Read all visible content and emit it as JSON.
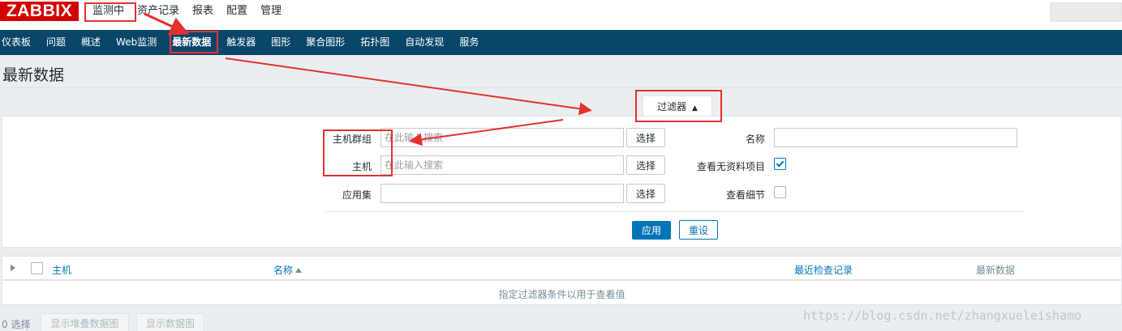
{
  "app": {
    "logo": "ZABBIX"
  },
  "top_nav": {
    "items": [
      {
        "label": "监测中",
        "active": true
      },
      {
        "label": "资产记录"
      },
      {
        "label": "报表"
      },
      {
        "label": "配置"
      },
      {
        "label": "管理"
      }
    ]
  },
  "sub_nav": {
    "items": [
      {
        "label": "仪表板"
      },
      {
        "label": "问题"
      },
      {
        "label": "概述"
      },
      {
        "label": "Web监测"
      },
      {
        "label": "最新数据",
        "active": true
      },
      {
        "label": "触发器"
      },
      {
        "label": "图形"
      },
      {
        "label": "聚合图形"
      },
      {
        "label": "拓扑图"
      },
      {
        "label": "自动发现"
      },
      {
        "label": "服务"
      }
    ]
  },
  "page": {
    "title": "最新数据"
  },
  "filter": {
    "tab_label": "过滤器",
    "host_groups": {
      "label": "主机群组",
      "placeholder": "在此输入搜索",
      "button": "选择"
    },
    "hosts": {
      "label": "主机",
      "placeholder": "在此输入搜索",
      "button": "选择"
    },
    "application": {
      "label": "应用集",
      "value": "",
      "button": "选择"
    },
    "name": {
      "label": "名称",
      "value": ""
    },
    "show_without_data": {
      "label": "查看无资料项目",
      "checked": true
    },
    "show_details": {
      "label": "查看细节",
      "checked": false
    },
    "apply_button": "应用",
    "reset_button": "重设"
  },
  "table": {
    "columns": {
      "host": "主机",
      "name": "名称",
      "last_check": "最近检查记录",
      "last_value": "最新数据"
    },
    "empty_message": "指定过滤器条件以用于查看值"
  },
  "footer": {
    "selected_count": "0 选择",
    "stacked_graph_button": "显示堆叠数据图",
    "graph_button": "显示数据图"
  },
  "watermark": "https://blog.csdn.net/zhangxueleishamo",
  "colors": {
    "brand_red": "#d40000",
    "subnav_bg": "#0a466a",
    "accent_blue": "#0275b8",
    "annotation_red": "#e4312f"
  }
}
